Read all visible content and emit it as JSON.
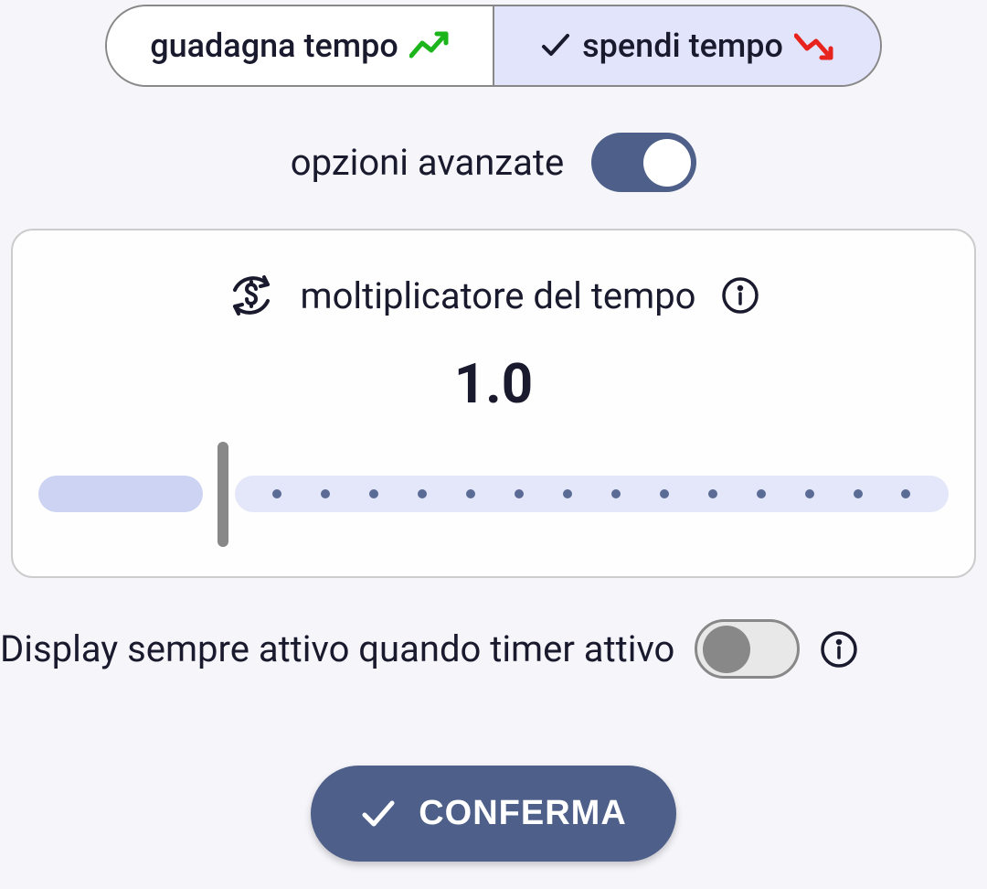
{
  "segments": {
    "gain": {
      "label": "guadagna tempo",
      "selected": false
    },
    "spend": {
      "label": "spendi tempo",
      "selected": true
    }
  },
  "advanced": {
    "label": "opzioni avanzate",
    "enabled": true
  },
  "multiplier": {
    "title": "moltiplicatore del tempo",
    "value": "1.0"
  },
  "display_always": {
    "label": "Display sempre attivo quando timer attivo",
    "enabled": false
  },
  "confirm": {
    "label": "CONFERMA"
  }
}
